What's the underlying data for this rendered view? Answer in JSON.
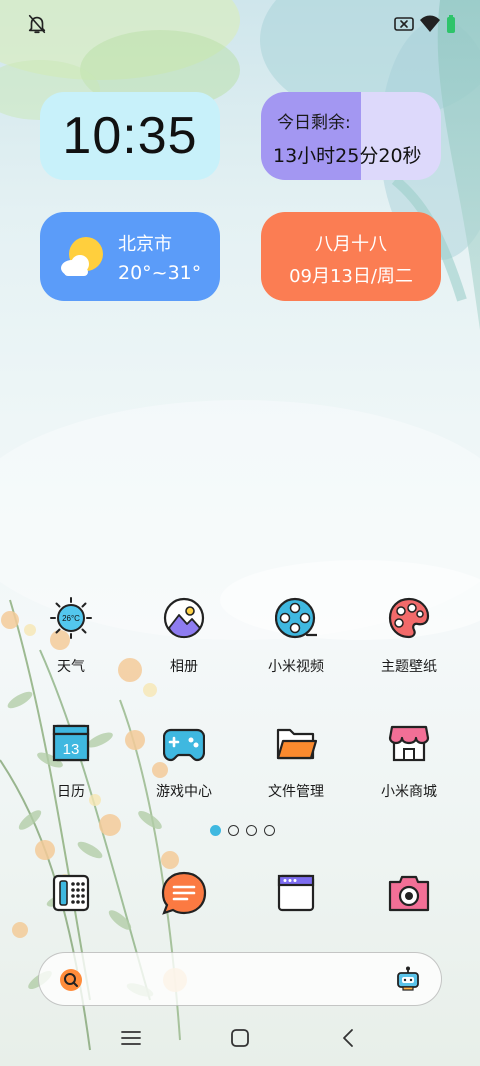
{
  "status_bar": {
    "icons": [
      "bell-mute-icon",
      "sim-none-icon",
      "wifi-icon",
      "battery-icon"
    ]
  },
  "widgets": {
    "clock": {
      "time": "10:35"
    },
    "time_remaining": {
      "title": "今日剩余:",
      "value": "13小时25分20秒"
    },
    "weather": {
      "city": "北京市",
      "temp": "20°~31°",
      "icon": "partly-cloudy-icon"
    },
    "date": {
      "lunar": "八月十八",
      "date": "09月13日/周二"
    }
  },
  "apps": [
    {
      "label": "天气",
      "icon": "weather-icon",
      "icon_text": "26°C"
    },
    {
      "label": "相册",
      "icon": "gallery-icon"
    },
    {
      "label": "小米视频",
      "icon": "video-reel-icon"
    },
    {
      "label": "主题壁纸",
      "icon": "palette-icon"
    },
    {
      "label": "日历",
      "icon": "calendar-icon",
      "icon_text": "13"
    },
    {
      "label": "游戏中心",
      "icon": "gamepad-icon"
    },
    {
      "label": "文件管理",
      "icon": "folder-icon"
    },
    {
      "label": "小米商城",
      "icon": "store-icon"
    }
  ],
  "page_indicator": {
    "count": 4,
    "active": 0
  },
  "dock": [
    "phone-icon",
    "messages-icon",
    "browser-icon",
    "camera-icon"
  ],
  "search_bar": {
    "icon": "search-icon",
    "assistant_icon": "assistant-robot-icon"
  },
  "nav_bar": [
    "menu-icon",
    "home-icon",
    "back-icon"
  ],
  "colors": {
    "clock_bg": "#c8f1fa",
    "remain_bg": "#a397f2",
    "weather_bg": "#5b9cf9",
    "date_bg": "#fb7d53",
    "accent_blue": "#3fb8e0"
  }
}
